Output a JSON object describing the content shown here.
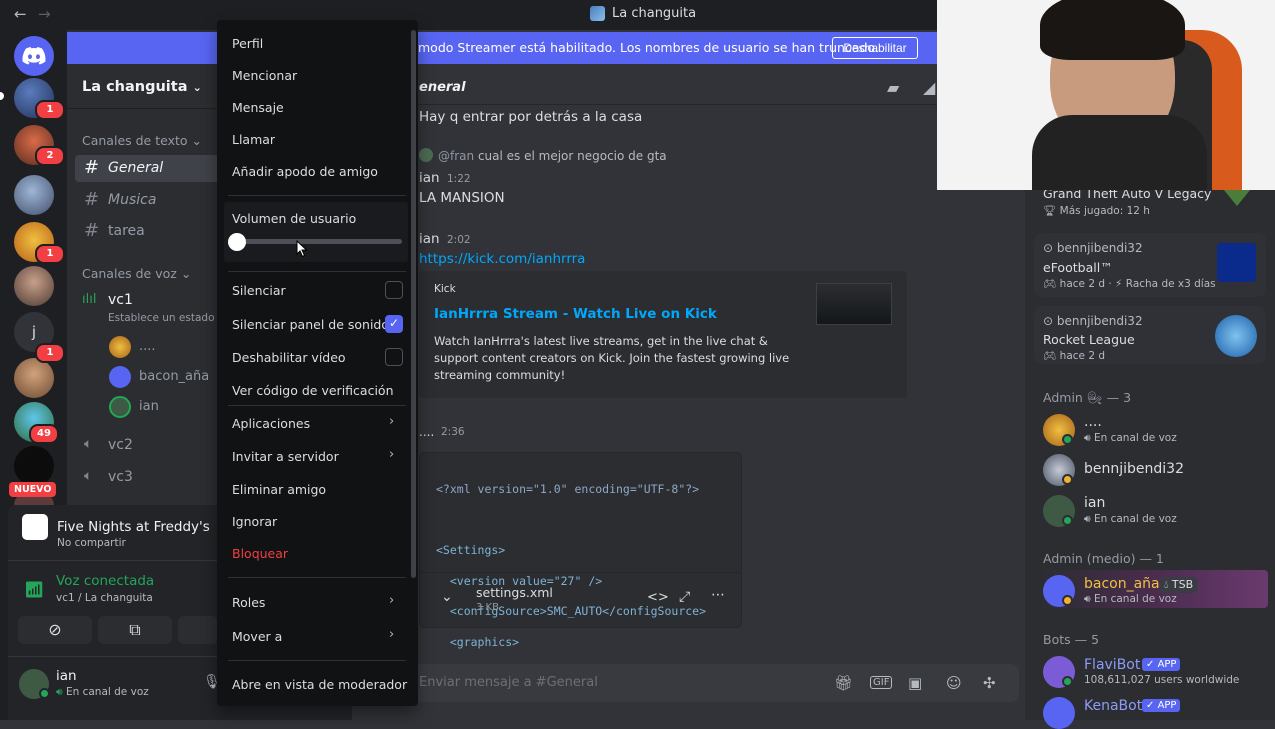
{
  "window": {
    "title": "La changuita"
  },
  "banner": {
    "text": "modo Streamer está habilitado. Los nombres de usuario se han truncado.",
    "button": "Deshabilitar"
  },
  "guilds": {
    "badges": [
      "1",
      "2",
      "1",
      "1",
      "49"
    ],
    "letter_server": "j",
    "new_label": "NUEVO"
  },
  "sidebar": {
    "server_name": "La changuita",
    "text_category": "Canales de texto",
    "text_channels": [
      "General",
      "Musica",
      "tarea"
    ],
    "voice_category": "Canales de voz",
    "voice_channels": [
      "vc1",
      "vc2",
      "vc3"
    ],
    "vc1_status": "Establece un estado d",
    "vc1_members": [
      "....",
      "bacon_aña",
      "ian"
    ]
  },
  "activity": {
    "game": "Five Nights at Freddy's",
    "sub": "No compartir"
  },
  "voice": {
    "title": "Voz conectada",
    "sub": "vc1 / La changuita"
  },
  "user": {
    "name": "ian",
    "status": "En canal de voz"
  },
  "chat": {
    "channel": "eneral",
    "messages": [
      {
        "text": "Hay q entrar por detrás  a la casa"
      },
      {
        "reply_user": "@fran",
        "reply_text": "cual es el mejor negocio de gta",
        "author": "ian",
        "time": "1:22",
        "text": "LA MANSION"
      },
      {
        "author": "ian",
        "time": "2:02",
        "link": "https://kick.com/ianhrrra"
      },
      {
        "author": "....",
        "time": "2:36"
      }
    ],
    "embed": {
      "provider": "Kick",
      "title": "IanHrrra Stream - Watch Live on Kick",
      "description": "Watch IanHrrra's latest live streams, get in the live chat & support content creators on Kick. Join the fastest growing live streaming community!"
    },
    "code_lines": [
      "<?xml version=\"1.0\" encoding=\"UTF-8\"?>",
      "",
      "<Settings>",
      "  <version value=\"27\" />",
      "  <configSource>SMC_AUTO</configSource>",
      "  <graphics>"
    ],
    "file": {
      "name": "settings.xml",
      "size": "3 KB"
    },
    "composer_placeholder": "Enviar mensaje a #General"
  },
  "context_menu": {
    "items": [
      "Perfil",
      "Mencionar",
      "Mensaje",
      "Llamar",
      "Añadir apodo de amigo"
    ],
    "volume_label": "Volumen de usuario",
    "volume_level": 0,
    "toggles": [
      {
        "label": "Silenciar",
        "checked": false
      },
      {
        "label": "Silenciar panel de sonidos",
        "checked": true
      },
      {
        "label": "Deshabilitar vídeo",
        "checked": false
      }
    ],
    "verify": "Ver código de verificación",
    "apps": "Aplicaciones",
    "invite": "Invitar a servidor",
    "remove_friend": "Eliminar amigo",
    "ignore": "Ignorar",
    "block": "Bloquear",
    "roles": "Roles",
    "move": "Mover a",
    "moderator": "Abre en vista de moderador"
  },
  "members": {
    "activities": [
      {
        "title": "Grand Theft Auto V Legacy",
        "sub": "Más jugado: 12 h"
      },
      {
        "user": "bennjibendi32",
        "title": "eFootball™",
        "sub": "hace 2 d",
        "extra": "Racha de x3 días"
      },
      {
        "user": "bennjibendi32",
        "title": "Rocket League",
        "sub": "hace 2 d"
      }
    ],
    "admin_header": "Admin",
    "admin_count": "— 3",
    "admins": [
      {
        "name": "....",
        "status": "En canal de voz"
      },
      {
        "name": "bennjibendi32",
        "status": ""
      },
      {
        "name": "ian",
        "status": "En canal de voz"
      }
    ],
    "admin_medio_header": "Admin (medio) — 1",
    "admin_medio": {
      "name": "bacon_aña",
      "tag": "TSB",
      "status": "En canal de voz"
    },
    "bots_header": "Bots — 5",
    "bots": [
      {
        "name": "FlaviBot",
        "tag": "APP",
        "sub": "108,611,027 users worldwide"
      },
      {
        "name": "KenaBot",
        "tag": "APP",
        "sub": ""
      }
    ]
  },
  "colors": {
    "blurple": "#5865f2",
    "danger": "#f23f43",
    "online": "#23a55a",
    "link": "#00a8fc"
  }
}
